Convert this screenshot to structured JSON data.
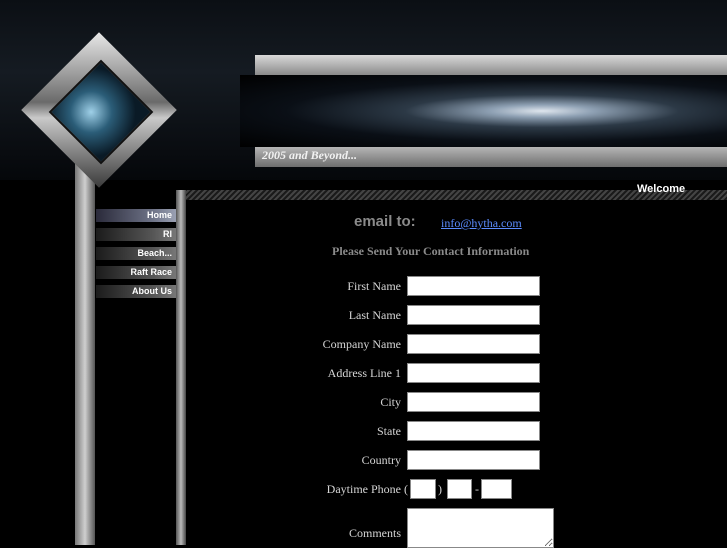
{
  "header": {
    "tagline": "2005 and Beyond..."
  },
  "nav": {
    "items": [
      {
        "label": "Home"
      },
      {
        "label": "RI"
      },
      {
        "label": "Beach..."
      },
      {
        "label": "Raft Race"
      },
      {
        "label": "About Us"
      }
    ],
    "welcome": "Welcome"
  },
  "contact": {
    "email_label": "email to:",
    "email_link": "info@hytha.com",
    "heading": "Please Send Your Contact Information"
  },
  "form": {
    "fields": {
      "first_name": {
        "label": "First Name",
        "value": ""
      },
      "last_name": {
        "label": "Last Name",
        "value": ""
      },
      "company_name": {
        "label": "Company Name",
        "value": ""
      },
      "address_line_1": {
        "label": "Address Line 1",
        "value": ""
      },
      "city": {
        "label": "City",
        "value": ""
      },
      "state": {
        "label": "State",
        "value": ""
      },
      "country": {
        "label": "Country",
        "value": ""
      },
      "daytime_phone": {
        "label": "Daytime Phone",
        "open_paren": "(",
        "close_paren": ")",
        "dash": "-"
      },
      "comments": {
        "label": "Comments",
        "value": ""
      }
    }
  },
  "colors": {
    "background": "#000000",
    "link": "#5b8cff",
    "muted_text": "#8a8a8a",
    "label_text": "#d6d6d6"
  }
}
